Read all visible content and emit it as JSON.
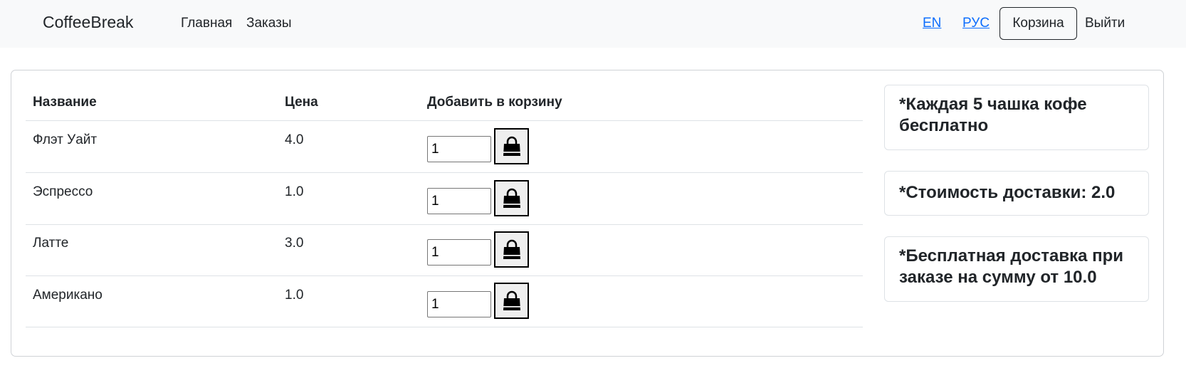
{
  "navbar": {
    "brand": "CoffeeBreak",
    "links": {
      "home": "Главная",
      "orders": "Заказы"
    },
    "lang": {
      "en": "EN",
      "ru": "РУС"
    },
    "cart": "Корзина",
    "logout": "Выйти"
  },
  "table": {
    "headers": {
      "name": "Название",
      "price": "Цена",
      "add": "Добавить в корзину"
    },
    "rows": [
      {
        "name": "Флэт Уайт",
        "price": "4.0",
        "qty": "1"
      },
      {
        "name": "Эспрессо",
        "price": "1.0",
        "qty": "1"
      },
      {
        "name": "Латте",
        "price": "3.0",
        "qty": "1"
      },
      {
        "name": "Американо",
        "price": "1.0",
        "qty": "1"
      }
    ]
  },
  "info": {
    "free_cup": "*Каждая 5 чашка кофе бесплатно",
    "delivery_cost": "*Стоимость доставки: 2.0",
    "free_delivery": "*Бесплатная доставка при заказе на сумму от 10.0"
  },
  "icons": {
    "add_to_cart": "shopping-bag-icon"
  },
  "colors": {
    "navbar_bg": "#f8f9fa",
    "link": "#0d6efd",
    "text": "#212529"
  }
}
